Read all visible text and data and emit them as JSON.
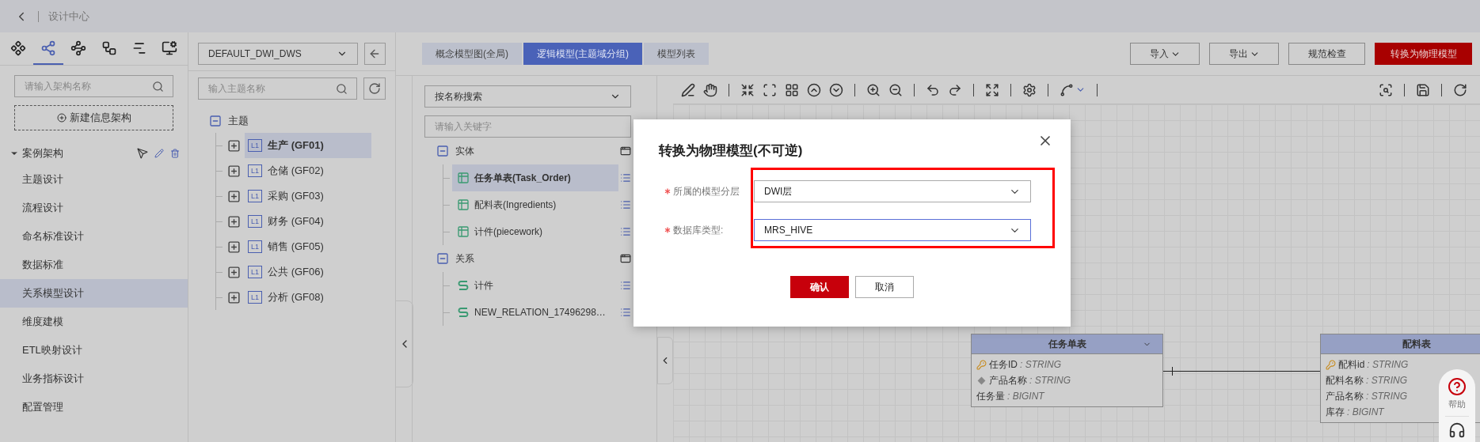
{
  "header": {
    "title": "设计中心"
  },
  "sidebar": {
    "icon_tabs": [
      {
        "selected": false
      },
      {
        "selected": true
      },
      {
        "selected": false
      },
      {
        "selected": false
      },
      {
        "selected": false
      },
      {
        "selected": false
      }
    ],
    "search": {
      "placeholder": "请输入架构名称"
    },
    "new_button": "新建信息架构",
    "tree": {
      "label": "案例架构",
      "expanded": true,
      "items": [
        {
          "label": "主题设计",
          "selected": false
        },
        {
          "label": "流程设计",
          "selected": false
        },
        {
          "label": "命名标准设计",
          "selected": false
        },
        {
          "label": "数据标准",
          "selected": false
        },
        {
          "label": "关系模型设计",
          "selected": true
        },
        {
          "label": "维度建模",
          "selected": false
        },
        {
          "label": "ETL映射设计",
          "selected": false
        },
        {
          "label": "业务指标设计",
          "selected": false
        },
        {
          "label": "配置管理",
          "selected": false
        }
      ]
    }
  },
  "subject_panel": {
    "layer_select": "DEFAULT_DWI_DWS",
    "search": {
      "placeholder": "输入主题名称"
    },
    "root": {
      "label": "主题",
      "expanded": true,
      "children": [
        {
          "tag": "L1",
          "label": "生产 (GF01)",
          "selected": true,
          "expanded": false
        },
        {
          "tag": "L1",
          "label": "仓储 (GF02)",
          "selected": false,
          "expanded": false
        },
        {
          "tag": "L1",
          "label": "采购 (GF03)",
          "selected": false,
          "expanded": false
        },
        {
          "tag": "L1",
          "label": "财务 (GF04)",
          "selected": false,
          "expanded": false
        },
        {
          "tag": "L1",
          "label": "销售 (GF05)",
          "selected": false,
          "expanded": false
        },
        {
          "tag": "L1",
          "label": "公共 (GF06)",
          "selected": false,
          "expanded": false
        },
        {
          "tag": "L1",
          "label": "分析 (GF08)",
          "selected": false,
          "expanded": false
        }
      ]
    }
  },
  "tabs": [
    {
      "label": "概念模型图(全局)",
      "selected": false
    },
    {
      "label": "逻辑模型(主题域分组)",
      "selected": true
    },
    {
      "label": "模型列表",
      "selected": false
    }
  ],
  "actions": [
    {
      "label": "导入",
      "kind": "dropdown"
    },
    {
      "label": "导出",
      "kind": "dropdown"
    },
    {
      "label": "规范检查",
      "kind": "default"
    },
    {
      "label": "转换为物理模型",
      "kind": "primary"
    }
  ],
  "model_tree": {
    "search_mode": "按名称搜索",
    "search": {
      "placeholder": "请输入关键字"
    },
    "groups": [
      {
        "label": "实体",
        "kind": "entity",
        "expanded": true,
        "children": [
          {
            "label": "任务单表(Task_Order)",
            "selected": true
          },
          {
            "label": "配料表(Ingredients)",
            "selected": false
          },
          {
            "label": "计件(piecework)",
            "selected": false
          }
        ]
      },
      {
        "label": "关系",
        "kind": "relation",
        "expanded": true,
        "children": [
          {
            "label": "计件",
            "selected": false
          },
          {
            "label": "NEW_RELATION_17496298…",
            "selected": false
          }
        ]
      }
    ]
  },
  "canvas": {
    "entities": [
      {
        "title": "任务单表",
        "toggle": true,
        "fields": [
          {
            "name": "任务ID",
            "type": ": STRING",
            "kind": "key"
          },
          {
            "name": "产品名称",
            "type": ": STRING",
            "kind": "index"
          },
          {
            "name": "任务量",
            "type": ": BIGINT",
            "kind": "plain"
          }
        ]
      },
      {
        "title": "配料表",
        "fields": [
          {
            "name": "配料id",
            "type": ": STRING",
            "kind": "key"
          },
          {
            "name": "配料名称",
            "type": ": STRING",
            "kind": "plain"
          },
          {
            "name": "产品名称",
            "type": ": STRING",
            "kind": "plain"
          },
          {
            "name": "库存",
            "type": ": BIGINT",
            "kind": "plain"
          }
        ]
      }
    ]
  },
  "help": {
    "label": "帮助"
  },
  "dialog": {
    "title": "转换为物理模型(不可逆)",
    "highlight": true,
    "fields": [
      {
        "label": "所属的模型分层",
        "required": true,
        "value": "DWI层",
        "focused": false
      },
      {
        "label": "数据库类型:",
        "required": true,
        "value": "MRS_HIVE",
        "focused": true
      }
    ],
    "buttons": [
      {
        "label": "确认",
        "kind": "primary"
      },
      {
        "label": "取消",
        "kind": "default"
      }
    ]
  }
}
